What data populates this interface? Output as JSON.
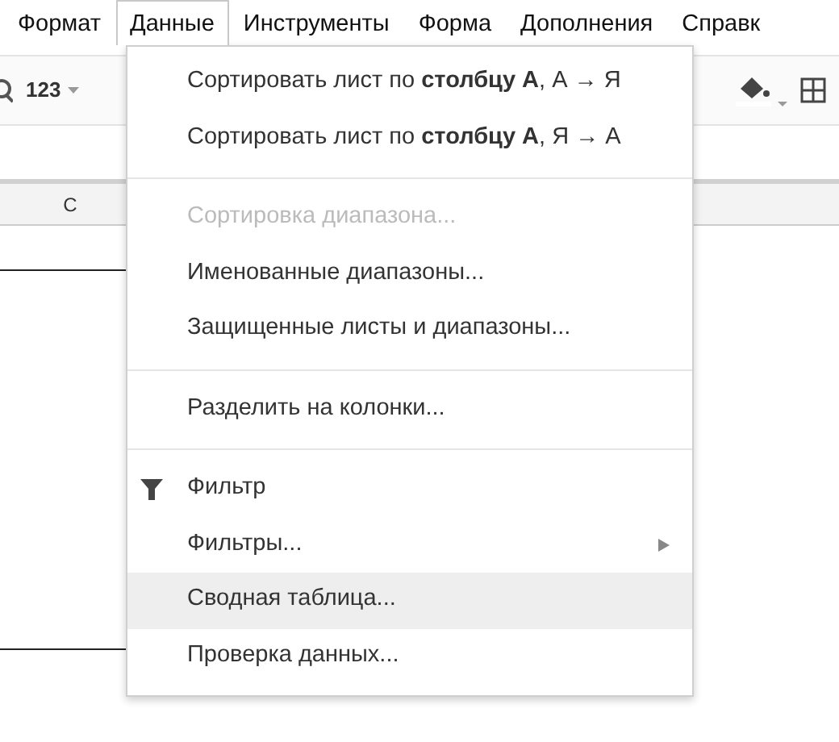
{
  "menubar": [
    {
      "label": "Формат",
      "selected": false
    },
    {
      "label": "Данные",
      "selected": true
    },
    {
      "label": "Инструменты",
      "selected": false
    },
    {
      "label": "Форма",
      "selected": false
    },
    {
      "label": "Дополнения",
      "selected": false
    },
    {
      "label": "Справк",
      "selected": false
    }
  ],
  "toolbar": {
    "number_format": "123"
  },
  "columns": [
    "C"
  ],
  "menu": [
    {
      "kind": "item",
      "label": "Сортировать лист по **столбцу A**, А → Я",
      "disabled": false,
      "selected": false
    },
    {
      "kind": "item",
      "label": "Сортировать лист по **столбцу A**, Я → А",
      "disabled": false,
      "selected": false
    },
    {
      "kind": "separator"
    },
    {
      "kind": "item",
      "label": "Сортировка диапазона...",
      "disabled": true,
      "selected": false
    },
    {
      "kind": "item",
      "label": "Именованные диапазоны...",
      "disabled": false,
      "selected": false
    },
    {
      "kind": "item",
      "label": "Защищенные листы и диапазоны...",
      "disabled": false,
      "selected": false
    },
    {
      "kind": "separator"
    },
    {
      "kind": "item",
      "label": "Разделить на колонки...",
      "disabled": false,
      "selected": false
    },
    {
      "kind": "separator"
    },
    {
      "kind": "filter",
      "label": "Фильтр",
      "disabled": false,
      "selected": false
    },
    {
      "kind": "submenu",
      "label": "Фильтры...",
      "disabled": false,
      "selected": false
    },
    {
      "kind": "item",
      "label": "Сводная таблица...",
      "disabled": false,
      "selected": true
    },
    {
      "kind": "item",
      "label": "Проверка данных...",
      "disabled": false,
      "selected": false
    }
  ]
}
